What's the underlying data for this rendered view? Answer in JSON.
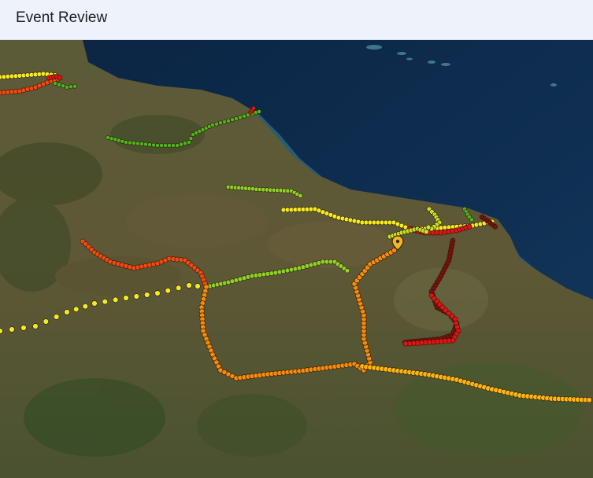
{
  "app": {
    "title": "Event Review"
  },
  "map": {
    "basemap": "satellite-3d-terrain",
    "colors": {
      "sea_deep": "#0e2a4a",
      "sea_shallow": "#2e6a80",
      "land": "#5a5a35",
      "dark_green": "#2a4a1e",
      "dark_red": "#7a0f0f",
      "red": "#e01414",
      "orange_red": "#f04a14",
      "orange": "#f58a0c",
      "amber": "#fbb410",
      "yellow": "#f4ea24",
      "yellow_green": "#c8e02a",
      "lime": "#8ed12a",
      "green": "#4fb31e"
    },
    "marker_icon": "location-pin-icon"
  }
}
